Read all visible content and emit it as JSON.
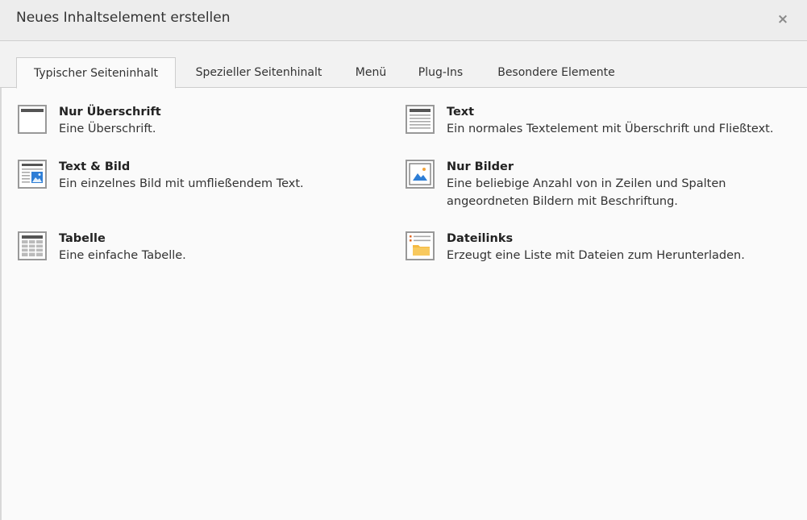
{
  "dialog": {
    "title": "Neues Inhaltselement erstellen",
    "close_label": "×"
  },
  "tabs": [
    {
      "label": "Typischer Seiteninhalt",
      "active": true
    },
    {
      "label": "Spezieller Seitenhinalt",
      "active": false
    },
    {
      "label": "Menü",
      "active": false
    },
    {
      "label": "Plug-Ins",
      "active": false
    },
    {
      "label": "Besondere Elemente",
      "active": false
    }
  ],
  "elements": [
    {
      "title": "Nur Überschrift",
      "desc_lines": [
        "Eine Überschrift."
      ],
      "icon": "header-only-icon"
    },
    {
      "title": "Text",
      "desc_lines": [
        "Ein normales Textelement mit Überschrift und Fließtext."
      ],
      "icon": "text-icon"
    },
    {
      "title": "Text & Bild",
      "desc_lines": [
        "Ein einzelnes Bild mit umfließendem Text."
      ],
      "icon": "text-image-icon"
    },
    {
      "title": "Nur Bilder",
      "desc_lines": [
        "Eine beliebige Anzahl von in Zeilen und Spalten",
        "angeordneten Bildern mit Beschriftung."
      ],
      "icon": "images-icon"
    },
    {
      "title": "Tabelle",
      "desc_lines": [
        "Eine einfache Tabelle."
      ],
      "icon": "table-icon"
    },
    {
      "title": "Dateilinks",
      "desc_lines": [
        "Erzeugt eine Liste mit Dateien zum Herunterladen."
      ],
      "icon": "file-links-icon"
    }
  ]
}
